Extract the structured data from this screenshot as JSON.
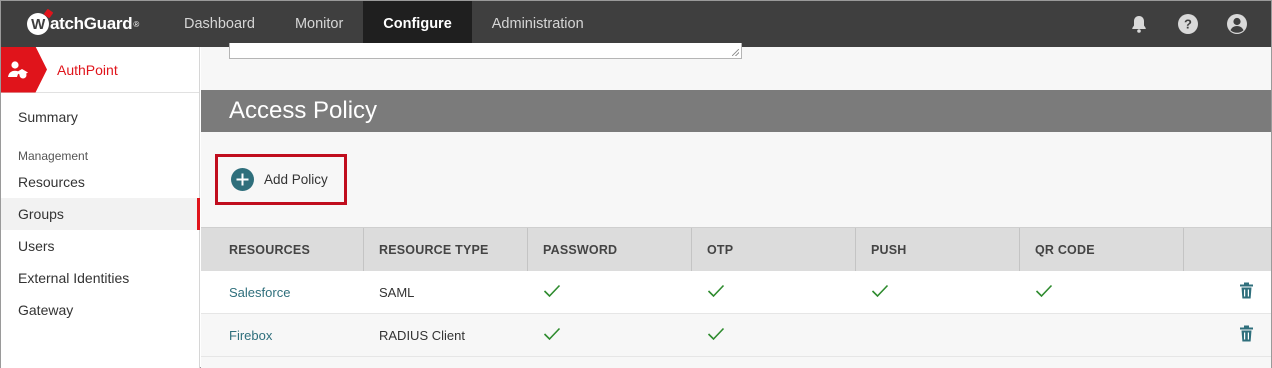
{
  "brand": {
    "name": "WatchGuard",
    "accent": "#e0141b"
  },
  "nav": {
    "items": [
      {
        "label": "Dashboard",
        "active": false
      },
      {
        "label": "Monitor",
        "active": false
      },
      {
        "label": "Configure",
        "active": true
      },
      {
        "label": "Administration",
        "active": false
      }
    ],
    "icons": [
      "bell-icon",
      "help-icon",
      "user-account-icon"
    ]
  },
  "sidebar": {
    "title": "AuthPoint",
    "summary": "Summary",
    "section": "Management",
    "items": [
      {
        "label": "Resources",
        "active": false
      },
      {
        "label": "Groups",
        "active": true
      },
      {
        "label": "Users",
        "active": false
      },
      {
        "label": "External Identities",
        "active": false
      },
      {
        "label": "Gateway",
        "active": false
      }
    ]
  },
  "main": {
    "section_title": "Access Policy",
    "add_button": "Add Policy",
    "table": {
      "headers": [
        "RESOURCES",
        "RESOURCE TYPE",
        "PASSWORD",
        "OTP",
        "PUSH",
        "QR CODE",
        ""
      ],
      "rows": [
        {
          "resource": "Salesforce",
          "type": "SAML",
          "password": true,
          "otp": true,
          "push": true,
          "qr": true
        },
        {
          "resource": "Firebox",
          "type": "RADIUS Client",
          "password": true,
          "otp": true,
          "push": false,
          "qr": false
        }
      ]
    }
  }
}
